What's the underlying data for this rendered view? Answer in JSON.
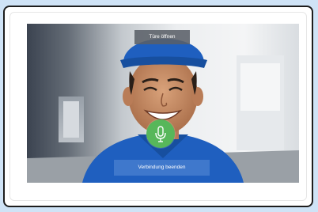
{
  "call": {
    "door_label": "Türe öffnen",
    "end_label": "Verbindung beenden",
    "mic_icon": "microphone-icon"
  },
  "colors": {
    "page_background": "#cfe3f6",
    "mic_button": "#57b75a",
    "end_button": "#3f78cc",
    "door_button": "#5a6068",
    "cap_and_shirt": "#1f5fbf"
  }
}
